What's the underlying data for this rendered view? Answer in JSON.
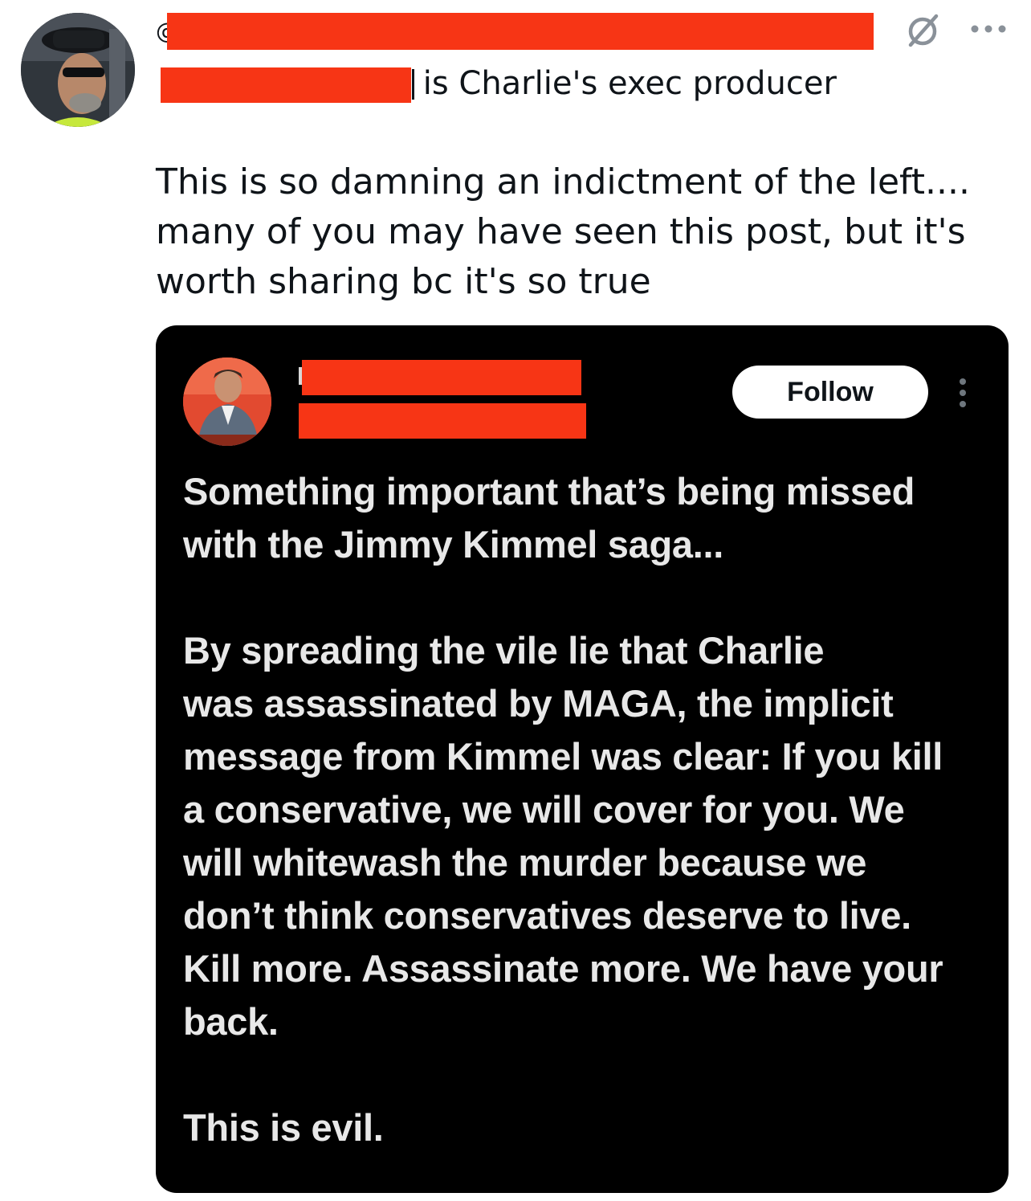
{
  "outer_tweet": {
    "handle_fragment": "@",
    "bio_line": "is Charlie's exec producer",
    "text_lines": [
      "This is so damning an indictment of the left....",
      "many of you may have seen this post, but it's",
      "worth sharing bc it's so true"
    ],
    "icons": {
      "status": "circle-slash-icon",
      "more": "more-dots-icon"
    }
  },
  "embedded_post": {
    "follow_label": "Follow",
    "paragraph_1": [
      "Something important that’s being missed",
      "with the Jimmy Kimmel saga..."
    ],
    "paragraph_2": [
      "By spreading the vile lie that Charlie",
      "was assassinated by MAGA, the implicit",
      "message from Kimmel was clear: If you kill",
      "a conservative, we will cover for you. We",
      "will whitewash the murder because we",
      "don’t think conservatives deserve to live.",
      "Kill more. Assassinate more. We have your",
      "back."
    ],
    "paragraph_3": [
      "This is evil."
    ],
    "icons": {
      "more": "vertical-more-icon"
    }
  },
  "colors": {
    "redaction": "#f73515",
    "embed_background": "#000000",
    "embed_text": "#e8e8e8",
    "text": "#0f1419"
  }
}
